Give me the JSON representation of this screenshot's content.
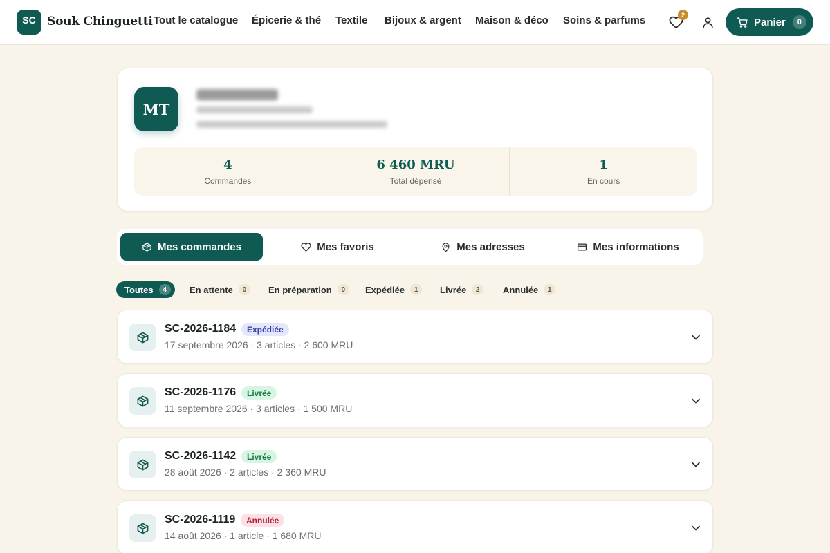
{
  "header": {
    "logo_initials": "SC",
    "brand": "Souk Chinguetti",
    "nav": [
      "Tout le catalogue",
      "Épicerie & thé",
      "Textile",
      "Bijoux & argent",
      "Maison & déco",
      "Soins & parfums"
    ],
    "favorites_count": "2",
    "cart_label": "Panier",
    "cart_count": "0"
  },
  "profile": {
    "initials": "MT",
    "stats": [
      {
        "value": "4",
        "label": "Commandes"
      },
      {
        "value": "6 460 MRU",
        "label": "Total dépensé"
      },
      {
        "value": "1",
        "label": "En cours"
      }
    ]
  },
  "tabs": [
    {
      "label": "Mes commandes",
      "icon": "box-icon",
      "active": true
    },
    {
      "label": "Mes favoris",
      "icon": "heart-icon",
      "active": false
    },
    {
      "label": "Mes adresses",
      "icon": "map-pin-icon",
      "active": false
    },
    {
      "label": "Mes informations",
      "icon": "card-icon",
      "active": false
    }
  ],
  "filters": [
    {
      "label": "Toutes",
      "count": "4",
      "active": true
    },
    {
      "label": "En attente",
      "count": "0",
      "active": false
    },
    {
      "label": "En préparation",
      "count": "0",
      "active": false
    },
    {
      "label": "Expédiée",
      "count": "1",
      "active": false
    },
    {
      "label": "Livrée",
      "count": "2",
      "active": false
    },
    {
      "label": "Annulée",
      "count": "1",
      "active": false
    }
  ],
  "orders": [
    {
      "id": "SC-2026-1184",
      "status": "Expédiée",
      "status_color": "#3b3fa8",
      "status_bg": "#e4e6fb",
      "meta": "17 septembre 2026 · 3 articles · 2 600 MRU"
    },
    {
      "id": "SC-2026-1176",
      "status": "Livrée",
      "status_color": "#17784a",
      "status_bg": "#d8f5e4",
      "meta": "11 septembre 2026 · 3 articles · 1 500 MRU"
    },
    {
      "id": "SC-2026-1142",
      "status": "Livrée",
      "status_color": "#17784a",
      "status_bg": "#d8f5e4",
      "meta": "28 août 2026 · 2 articles · 2 360 MRU"
    },
    {
      "id": "SC-2026-1119",
      "status": "Annulée",
      "status_color": "#b3213b",
      "status_bg": "#fbe1e5",
      "meta": "14 août 2026 · 1 article · 1 680 MRU"
    }
  ],
  "colors": {
    "brand": "#0f5a52",
    "background": "#f9f4ea",
    "accent": "#c98b2b"
  }
}
